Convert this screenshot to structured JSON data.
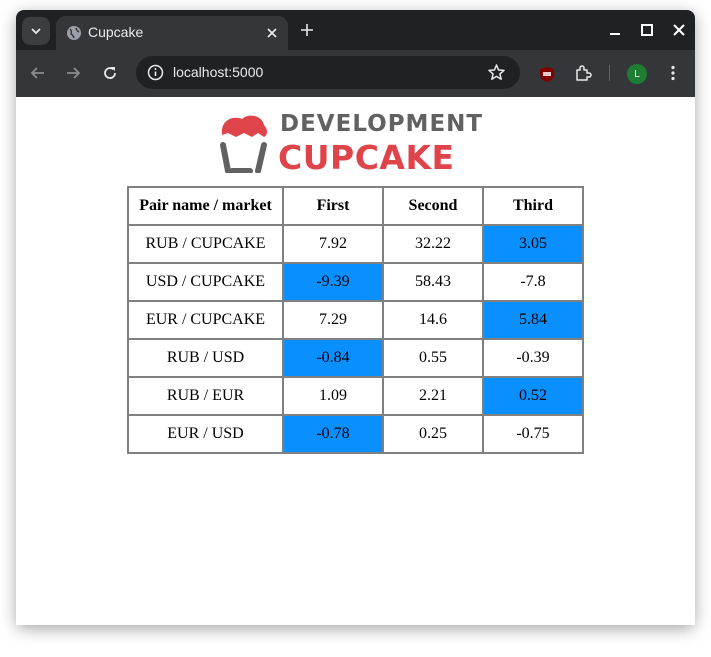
{
  "browser": {
    "tab_title": "Cupcake",
    "url": "localhost:5000",
    "profile_initial": "L"
  },
  "logo": {
    "line1": "DEVELOPMENT",
    "line2": "CUPCAKE",
    "colors": {
      "line1": "#616161",
      "line2": "#e0444b"
    }
  },
  "table": {
    "headers": [
      "Pair name / market",
      "First",
      "Second",
      "Third"
    ],
    "highlight_color": "#0a8fff",
    "rows": [
      {
        "pair": "RUB / CUPCAKE",
        "values": [
          "7.92",
          "32.22",
          "3.05"
        ],
        "highlight_index": 2
      },
      {
        "pair": "USD / CUPCAKE",
        "values": [
          "-9.39",
          "58.43",
          "-7.8"
        ],
        "highlight_index": 0
      },
      {
        "pair": "EUR / CUPCAKE",
        "values": [
          "7.29",
          "14.6",
          "5.84"
        ],
        "highlight_index": 2
      },
      {
        "pair": "RUB / USD",
        "values": [
          "-0.84",
          "0.55",
          "-0.39"
        ],
        "highlight_index": 0
      },
      {
        "pair": "RUB / EUR",
        "values": [
          "1.09",
          "2.21",
          "0.52"
        ],
        "highlight_index": 2
      },
      {
        "pair": "EUR / USD",
        "values": [
          "-0.78",
          "0.25",
          "-0.75"
        ],
        "highlight_index": 0
      }
    ]
  }
}
